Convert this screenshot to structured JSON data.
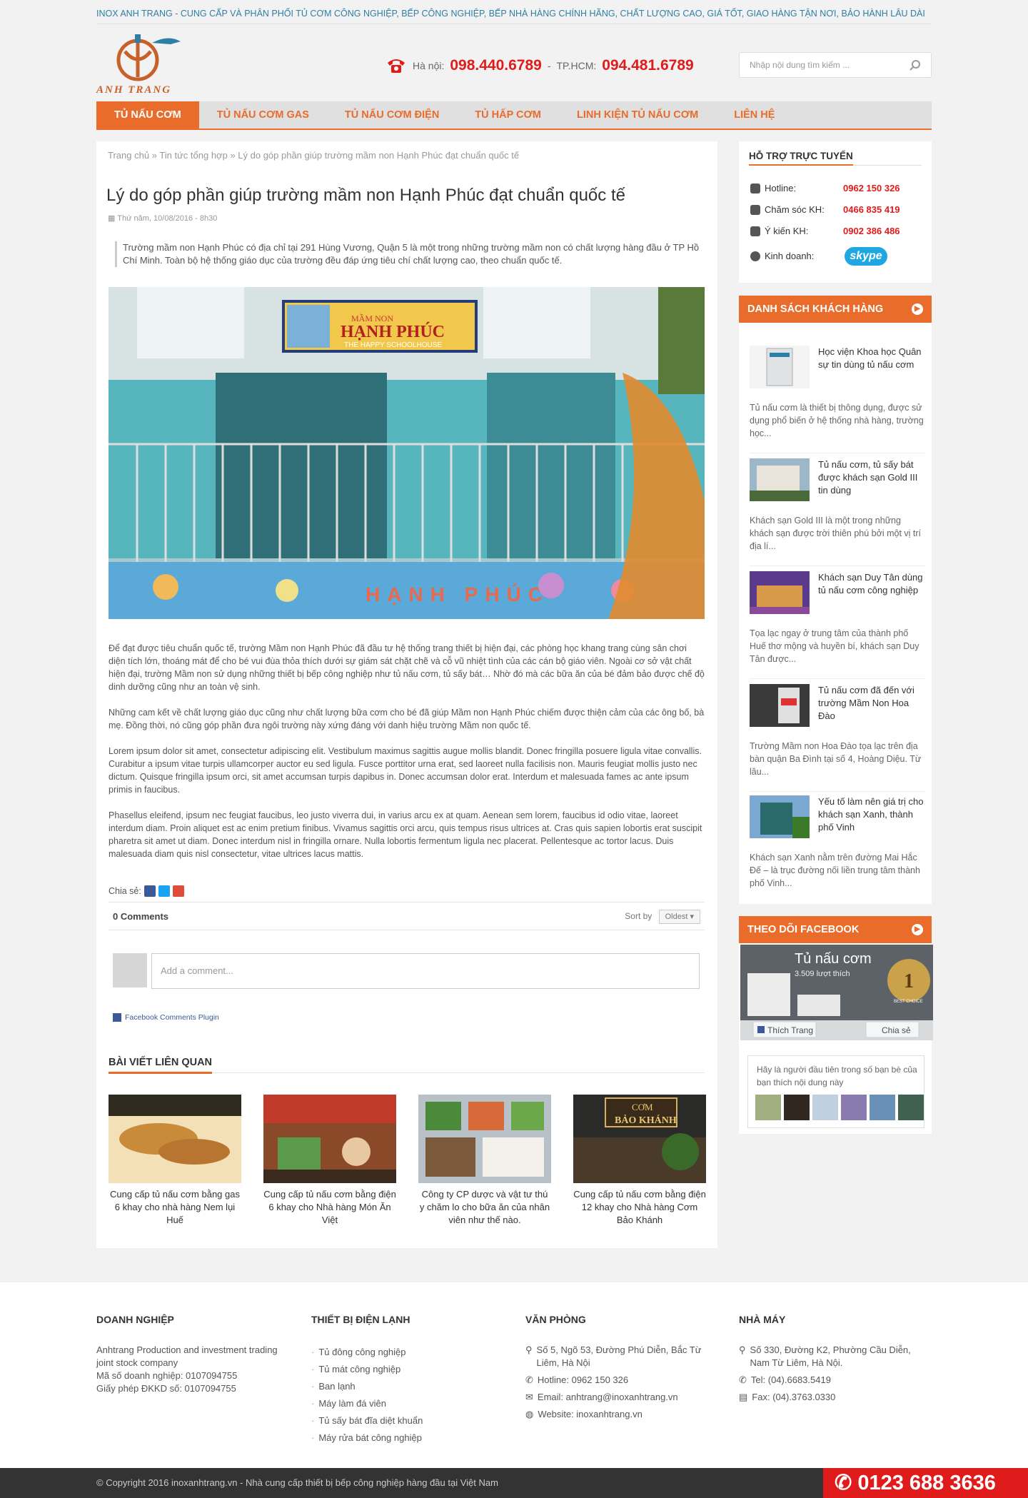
{
  "topbar": {
    "slogan": "INOX ANH TRANG - CUNG CẤP VÀ PHÂN PHỐI TỦ CƠM CÔNG NGHIỆP, BẾP CÔNG NGHIỆP, BẾP NHÀ HÀNG CHÍNH HÃNG, CHẤT LƯỢNG CAO, GIÁ TỐT, GIAO HÀNG TẬN NƠI, BẢO HÀNH LÂU DÀI"
  },
  "logo": {
    "text": "ANH TRANG"
  },
  "hotline": {
    "hn_label": "Hà nội:",
    "hn_number": "098.440.6789",
    "sep": "-",
    "hcm_label": "TP.HCM:",
    "hcm_number": "094.481.6789"
  },
  "search": {
    "placeholder": "Nhập nội dung tìm kiếm ..."
  },
  "nav": {
    "items": [
      "TỦ NẤU CƠM",
      "TỦ NẤU CƠM GAS",
      "TỦ NẤU CƠM ĐIỆN",
      "TỦ HẤP CƠM",
      "LINH KIỆN TỦ NẤU CƠM",
      "LIÊN HỆ"
    ]
  },
  "breadcrumb": {
    "home": "Trang chủ",
    "cat": "Tin tức tổng hợp",
    "current": "Lý do góp phần giúp trường mầm non Hạnh Phúc đạt chuẩn quốc tế"
  },
  "article": {
    "title": "Lý do góp phần giúp trường mầm non Hạnh Phúc đạt chuẩn quốc tế",
    "date": "Thứ năm, 10/08/2016 - 8h30",
    "lead": "Trường mầm non Hạnh Phúc có địa chỉ tại 291 Hùng Vương, Quận 5 là một trong những trường mầm non có chất lượng hàng đầu ở TP Hồ Chí Minh. Toàn bộ hệ thống giáo dục của trường đều đáp ứng tiêu chí chất lượng cao, theo chuẩn quốc tế.",
    "sign_top": "MẦM NON",
    "sign_main": "HẠNH PHÚC",
    "sign_sub": "THE HAPPY SCHOOLHOUSE",
    "mural_text": "HẠNH PHÚC",
    "p1": "Để đạt được tiêu chuẩn quốc tế, trường Mầm non Hạnh Phúc đã đầu tư hệ thống trang thiết bị hiện đại, các phòng học khang trang cùng sân chơi diện tích lớn, thoáng mát để cho bé vui đùa thỏa thích dưới sự giám sát chặt chẽ và cỗ vũ nhiệt tình của các cán bộ giáo viên. Ngoài cơ sở vật chất hiện đại, trường Mầm non sử dụng những thiết bị bếp công nghiệp như tủ nấu cơm, tủ sấy bát… Nhờ đó mà các bữa ăn của bé đảm bảo được chế độ dinh dưỡng cũng như an toàn vệ sinh.",
    "p2": "Những cam kết về chất lượng giáo dục cũng như chất lượng bữa cơm cho bé đã giúp Mầm non Hạnh Phúc chiếm được thiện cảm của các ông bố, bà mẹ. Đồng thời, nó cũng góp phần đưa ngôi trường này xứng đáng với danh hiệu trường Mầm non quốc tế.",
    "p3": "Lorem ipsum dolor sit amet, consectetur adipiscing elit. Vestibulum maximus sagittis augue mollis blandit. Donec fringilla posuere ligula vitae convallis. Curabitur a ipsum vitae turpis ullamcorper auctor eu sed ligula. Fusce porttitor urna erat, sed laoreet nulla facilisis non. Mauris feugiat mollis justo nec dictum. Quisque fringilla ipsum orci, sit amet accumsan turpis dapibus in. Donec accumsan dolor erat. Interdum et malesuada fames ac ante ipsum primis in faucibus.",
    "p4": "Phasellus eleifend, ipsum nec feugiat faucibus, leo justo viverra dui, in varius arcu ex at quam. Aenean sem lorem, faucibus id odio vitae, laoreet interdum diam. Proin aliquet est ac enim pretium finibus. Vivamus sagittis orci arcu, quis tempus risus ultrices at. Cras quis sapien lobortis erat suscipit pharetra sit amet ut diam. Donec interdum nisl in fringilla ornare. Nulla lobortis fermentum ligula nec placerat. Pellentesque ac tortor lacus. Duis malesuada diam quis nisl consectetur, vitae ultrices lacus mattis."
  },
  "share": {
    "label": "Chia sẻ:"
  },
  "comments": {
    "count": "0 Comments",
    "sort_label": "Sort by",
    "sort_value": "Oldest ▾",
    "placeholder": "Add a comment...",
    "plugin": "Facebook Comments Plugin"
  },
  "related": {
    "heading": "BÀI VIẾT LIÊN QUAN",
    "items": [
      {
        "caption": "Cung cấp tủ nấu cơm bằng gas 6 khay cho nhà hàng Nem lụi Huế"
      },
      {
        "caption": "Cung cấp tủ nấu cơm bằng điện 6 khay cho Nhà hàng Món Ăn Việt"
      },
      {
        "caption": "Công ty CP dược và vật tư thú y chăm lo cho bữa ăn của nhân viên như thế nào."
      },
      {
        "caption": "Cung cấp tủ nấu cơm bằng điện 12 khay cho Nhà hàng Cơm Bảo Khánh"
      }
    ],
    "sign_line1": "CƠM",
    "sign_line2": "BẢO KHÁNH"
  },
  "support": {
    "heading": "HỖ TRỢ TRỰC TUYẾN",
    "rows": [
      {
        "label": "Hotline:",
        "value": "0962 150 326"
      },
      {
        "label": "Chăm sóc KH:",
        "value": "0466 835 419"
      },
      {
        "label": "Ý kiến KH:",
        "value": "0902 386 486"
      },
      {
        "label": "Kinh doanh:",
        "value": "skype"
      }
    ]
  },
  "customers": {
    "heading": "DANH SÁCH KHÁCH HÀNG",
    "items": [
      {
        "name": "Học viện Khoa học Quân sự tin dùng tủ nấu cơm",
        "desc": "Tủ nấu cơm là thiết bị thông dụng, được sử dụng phổ biến ở hệ thống nhà hàng, trường học..."
      },
      {
        "name": "Tủ nấu cơm, tủ sấy bát được khách sạn Gold III tin dùng",
        "desc": "Khách sạn Gold III là một trong những khách sạn được trời thiên phú bởi một vị trí địa lí..."
      },
      {
        "name": "Khách sạn Duy Tân dùng tủ nấu cơm công nghiệp",
        "desc": "Tọa lạc ngay ở trung tâm của thành phố Huế thơ mộng và huyền bí, khách sạn Duy Tân được..."
      },
      {
        "name": "Tủ nấu cơm đã đến với trường Mầm Non Hoa Đào",
        "desc": "Trường Mầm non Hoa Đào tọa lạc trên địa bàn quận Ba Đình tại số 4, Hoàng Diệu. Từ lâu..."
      },
      {
        "name": "Yếu tố làm nên giá trị cho khách sạn Xanh, thành phố Vinh",
        "desc": "Khách sạn Xanh nằm trên đường Mai Hắc Đế – là trục đường nối liền trung tâm thành phố Vinh..."
      }
    ]
  },
  "facebook": {
    "heading": "THEO DÕI FACEBOOK",
    "page_name": "Tủ nấu cơm",
    "likes": "3.509 lượt thích",
    "like_btn": "Thích Trang",
    "share_btn": "Chia sẻ",
    "faces_text": "Hãy là người đầu tiên trong số bạn bè của bạn thích nội dung này",
    "badge": "1",
    "badge_sub": "BEST CHOICE"
  },
  "footer": {
    "col1": {
      "heading": "DOANH NGHIỆP",
      "line1": "Anhtrang Production and investment trading joint stock company",
      "line2": "Mã số doanh nghiệp: 0107094755",
      "line3": "Giấy phép ĐKKD số: 0107094755"
    },
    "col2": {
      "heading": "THIẾT BỊ ĐIỆN LẠNH",
      "items": [
        "Tủ đông công nghiệp",
        "Tủ mát công nghiệp",
        "Ban lạnh",
        "Máy làm đá viên",
        "Tủ sấy bát đĩa diệt khuẩn",
        "Máy rửa bát công nghiệp"
      ]
    },
    "col3": {
      "heading": "VĂN PHÒNG",
      "address": "Số 5, Ngõ 53, Đường Phú Diễn, Bắc Từ Liêm, Hà Nội",
      "hotline": "Hotline: 0962 150 326",
      "email": "Email: anhtrang@inoxanhtrang.vn",
      "website": "Website: inoxanhtrang.vn"
    },
    "col4": {
      "heading": "NHÀ MÁY",
      "address": "Số 330, Đường K2, Phường Cầu Diễn, Nam Từ Liêm, Hà Nội.",
      "tel": "Tel: (04).6683.5419",
      "fax": "Fax: (04).3763.0330"
    }
  },
  "copyright": "© Copyright 2016 inoxanhtrang.vn - Nhà cung cấp thiết bị bếp công nghiệp hàng đầu tại Việt Nam",
  "bottom_hotline": "0123 688 3636",
  "colors": {
    "accent": "#e96c2a",
    "red": "#e01b1b",
    "topbar": "#2d7fa5"
  }
}
